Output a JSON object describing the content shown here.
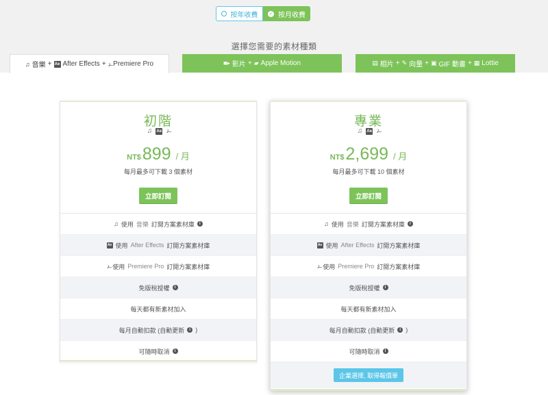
{
  "billing": {
    "yearly_label": "按年收費",
    "monthly_label": "按月收費",
    "selected": "monthly"
  },
  "choose_title": "選擇您需要的素材種類",
  "tabs": [
    {
      "icons": [
        "music-icon",
        "after-effects-icon",
        "premiere-pro-icon"
      ],
      "parts": [
        "音樂",
        "After Effects",
        "Premiere Pro"
      ],
      "active": true
    },
    {
      "icons": [
        "video-camera-icon",
        "apple-motion-icon"
      ],
      "parts": [
        "影片",
        "Apple Motion"
      ],
      "active": false
    },
    {
      "icons": [
        "photo-file-icon",
        "vector-pen-icon",
        "gif-icon",
        "lottie-icon"
      ],
      "parts": [
        "相片",
        "向量",
        "GIF 動畫",
        "Lottie"
      ],
      "active": false
    }
  ],
  "plans": [
    {
      "name": "初階",
      "currency": "NT$",
      "price": "899",
      "per": "/ 月",
      "quota": "每月最多可下載 3 個素材",
      "button": "立即訂閱"
    },
    {
      "name": "專業",
      "currency": "NT$",
      "price": "2,699",
      "per": "/ 月",
      "quota": "每月最多可下載 10 個素材",
      "button": "立即訂閱",
      "enterprise_button": "企業選擇, 取得報價單"
    }
  ],
  "features": {
    "music": {
      "prefix": "使用",
      "highlight": "音樂",
      "suffix": "訂閱方案素材庫"
    },
    "ae": {
      "prefix": "使用",
      "highlight": "After Effects",
      "suffix": "訂閱方案素材庫"
    },
    "pr": {
      "prefix": "使用",
      "highlight": "Premiere Pro",
      "suffix": "訂閱方案素材庫"
    },
    "royalty": "免版稅授權",
    "daily": "每天都有新素材加入",
    "auto_billing": "每月自動扣款 (自動更新",
    "cancel": "可隨時取消"
  },
  "colors": {
    "accent_green": "#7dc35a",
    "accent_blue": "#5bc6e8",
    "panel_gray": "#f1f1f1"
  }
}
